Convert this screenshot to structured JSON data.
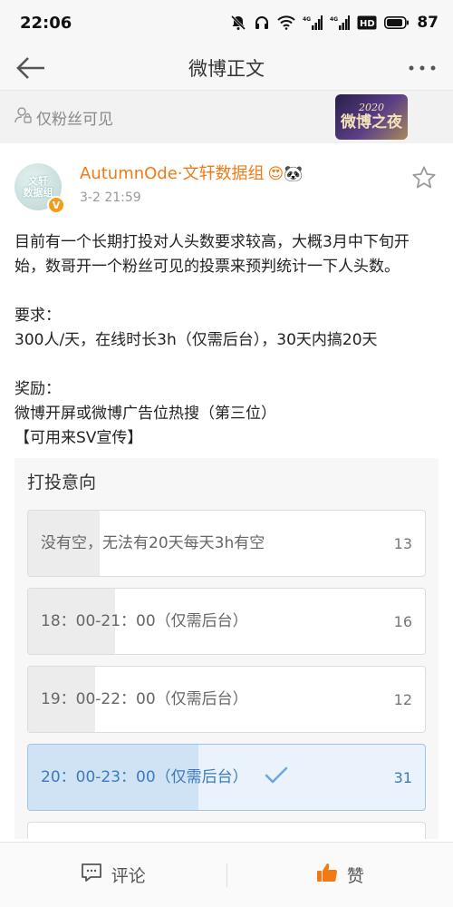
{
  "status": {
    "time": "22:06",
    "battery": "87",
    "network_labels": [
      "4G",
      "4G"
    ],
    "hd_label": "HD"
  },
  "nav": {
    "title": "微博正文"
  },
  "visibility": {
    "label": "仅粉丝可见",
    "badge_year": "2020",
    "badge_name": "微博之夜"
  },
  "post": {
    "avatar_text_1": "文轩",
    "avatar_text_2": "数据组",
    "verified_mark": "V",
    "author": "AutumnOde·文轩数据组",
    "author_emojis": "😍🐼",
    "time": "3-2 21:59",
    "body": {
      "intro": "目前有一个长期打投对人头数要求较高，大概3月中下旬开始，数哥开一个粉丝可见的投票来预判统计一下人头数。",
      "req_title": "要求：",
      "req_text": "300人/天，在线时长3h（仅需后台），30天内搞20天",
      "reward_title": "奖励：",
      "reward_line1": "微博开屏或微博广告位热搜（第三位）",
      "reward_line2": "【可用来SV宣传】"
    }
  },
  "poll": {
    "title": "打投意向",
    "options": [
      {
        "label": "没有空，无法有20天每天3h有空",
        "count": "13",
        "share": 0.18,
        "selected": false
      },
      {
        "label": "18：00-21：00（仅需后台）",
        "count": "16",
        "share": 0.22,
        "selected": false
      },
      {
        "label": "19：00-22：00（仅需后台）",
        "count": "12",
        "share": 0.17,
        "selected": false
      },
      {
        "label": "20：00-23：00（仅需后台）",
        "count": "31",
        "share": 0.43,
        "selected": true
      }
    ]
  },
  "bottom": {
    "comment_label": "评论",
    "like_label": "赞"
  },
  "colors": {
    "author": "#f07b15",
    "selected_text": "#3b7bbd",
    "like_icon": "#f07b15"
  }
}
